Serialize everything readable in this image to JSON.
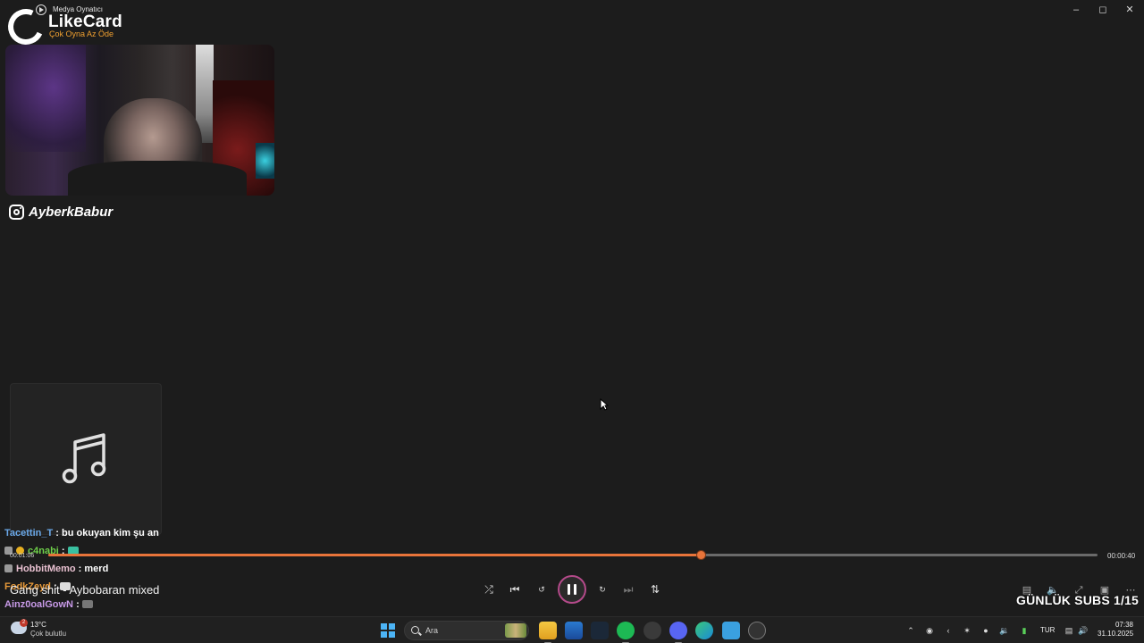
{
  "window": {
    "title": "Medya Oynatıcı",
    "controls": [
      "minimize",
      "maximize",
      "close"
    ]
  },
  "overlay": {
    "logo_name": "LikeCard",
    "logo_tagline": "Çok Oyna  Az Öde",
    "instagram_handle": "AyberkBabur",
    "daily_subs": "GÜNLÜK SUBS 1/15"
  },
  "chat": [
    {
      "user": "Tacettin_T",
      "message": ": bu okuyan kim şu an",
      "color": "#6aa8e8"
    },
    {
      "user": "c4nabi",
      "message": ":",
      "color": "#6fd04a"
    },
    {
      "user": "HobbitMemo",
      "message": ": merd",
      "color": "#e8c0d0"
    },
    {
      "user": "FodkZeyd",
      "message": ":",
      "color": "#e89a3a"
    },
    {
      "user": "Ainz0oalGowN",
      "message": ":",
      "color": "#c89ae8"
    }
  ],
  "player": {
    "song_title": "Gang shit - Aybobaran mixed",
    "elapsed": "00:01:06",
    "duration": "00:00:40",
    "progress": 0.622,
    "accent": "#e8743a"
  },
  "taskbar": {
    "weather_temp": "13°C",
    "weather_desc": "Çok bulutlu",
    "weather_badge": "2",
    "search_placeholder": "Ara",
    "language": "TUR",
    "time": "07:38",
    "date": "31.10.2025"
  }
}
